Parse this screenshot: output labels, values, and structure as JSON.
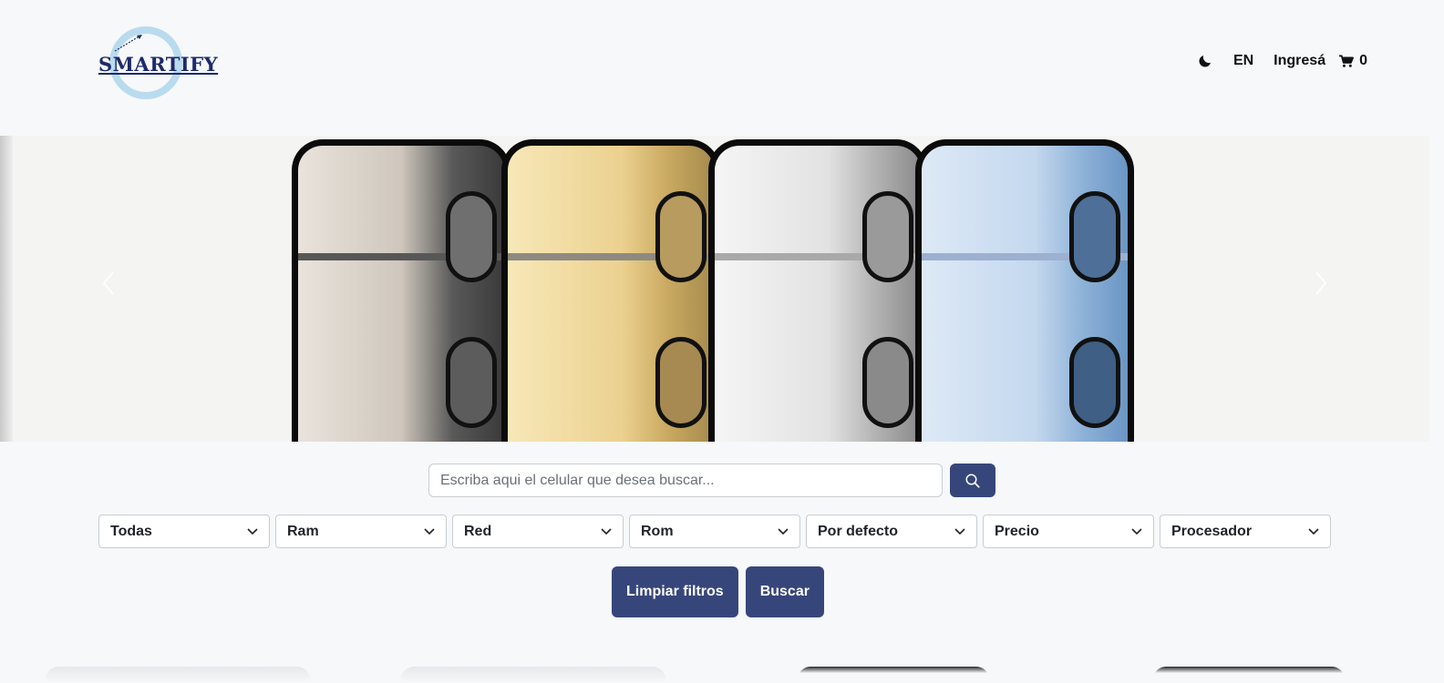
{
  "header": {
    "logo_text": "SMARTIFY",
    "lang": "EN",
    "login": "Ingresá",
    "cart_count": "0"
  },
  "search": {
    "placeholder": "Escriba aqui el celular que desea buscar..."
  },
  "filters": [
    "Todas",
    "Ram",
    "Red",
    "Rom",
    "Por defecto",
    "Precio",
    "Procesador"
  ],
  "actions": {
    "clear": "Limpiar filtros",
    "search": "Buscar"
  },
  "colors": {
    "primary": "#37467a",
    "background": "#f6f8fa",
    "logo_ring": "#b9dbee"
  },
  "icons": [
    "moon-icon",
    "cart-icon",
    "search-icon",
    "chevron-down-icon",
    "chevron-left-icon",
    "chevron-right-icon"
  ]
}
